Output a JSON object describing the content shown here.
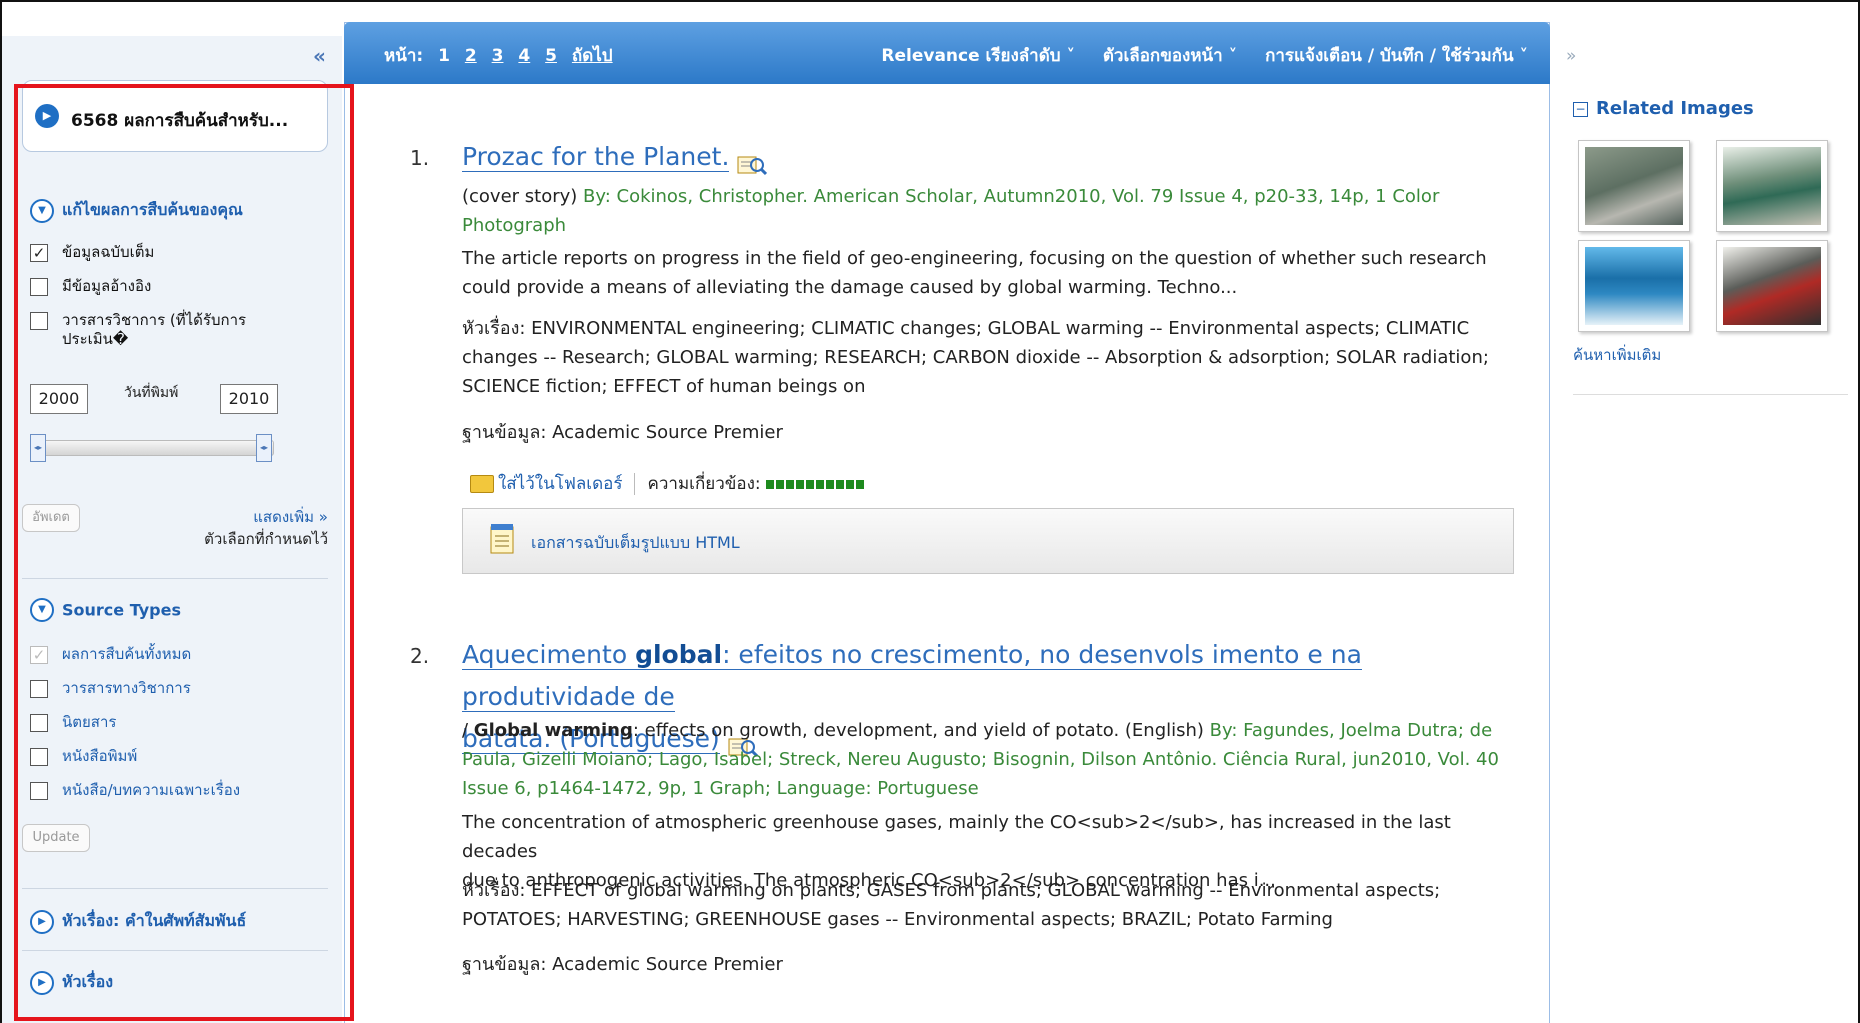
{
  "sidebar": {
    "collapse_label": "«",
    "results_count": "6568 ผลการสืบค้นสำหรับ...",
    "refine": {
      "heading": "แก้ไขผลการสืบค้นของคุณ",
      "full_text": "ข้อมูลฉบับเต็ม",
      "references": "มีข้อมูลอ้างอิง",
      "peer_reviewed_line1": "วารสารวิชาการ (ที่ได้รับการ",
      "peer_reviewed_line2": "ประเมิน�",
      "full_text_checked": true,
      "year_from": "2000",
      "year_label": "วันที่พิมพ์",
      "year_to": "2010",
      "update_label": "อัพเดต",
      "show_more": "แสดงเพิ่ม »",
      "options_set": "ตัวเลือกที่กำหนดไว้"
    },
    "source_types": {
      "heading": "Source Types",
      "items": [
        "ผลการสืบค้นทั้งหมด",
        "วารสารทางวิชาการ",
        "นิตยสาร",
        "หนังสือพิมพ์",
        "หนังสือ/บทความเฉพาะเรื่อง"
      ],
      "all_checked": true,
      "update_label": "Update"
    },
    "subject_thesaurus": "หัวเรื่อง: คำในศัพท์สัมพันธ์",
    "subject": "หัวเรื่อง"
  },
  "toolbar": {
    "page_label": "หน้า:",
    "pages": [
      "1",
      "2",
      "3",
      "4",
      "5"
    ],
    "next": "ถัดไป",
    "sort": "Relevance เรียงลำดับ ˅",
    "page_options": "ตัวเลือกของหน้า ˅",
    "alerts": "การแจ้งเตือน / บันทึก / ใช้ร่วมกัน ˅"
  },
  "results": [
    {
      "num": "1.",
      "title": "Prozac for the Planet.",
      "meta_prefix": "(cover story) ",
      "meta_line1": "By: Cokinos, Christopher. American Scholar, Autumn2010, Vol. 79 Issue 4, p20-33, 14p, 1 Color",
      "meta_line2": "Photograph",
      "abstract_line1": "The article reports on progress in the field of geo-engineering, focusing on the question of whether such research",
      "abstract_line2": "could provide a means of alleviating the damage caused by global warming. Techno...",
      "subjects_line1": "หัวเรื่อง: ENVIRONMENTAL engineering; CLIMATIC changes; GLOBAL warming -- Environmental aspects; CLIMATIC",
      "subjects_line2": "changes -- Research; GLOBAL warming; RESEARCH; CARBON dioxide -- Absorption & adsorption; SOLAR radiation;",
      "subjects_line3": "SCIENCE fiction; EFFECT of human beings on",
      "database": "ฐานข้อมูล: Academic Source Premier",
      "folder": "ใส่ไว้ในโฟลเดอร์",
      "relevance": "ความเกี่ยวข้อง:",
      "html_full_text": "เอกสารฉบับเต็มรูปแบบ HTML"
    },
    {
      "num": "2.",
      "title_a": "Aquecimento ",
      "title_b": "global",
      "title_c": ": efeitos no crescimento, no desenvols imento e na produtividade de",
      "title_d": "batata. (Portuguese)",
      "meta_a": "/ ",
      "meta_b": "Global warming",
      "meta_c": ": effects on growth, development, and yield of potato. (English) ",
      "meta_d": "By: Fagundes, Joelma Dutra; de",
      "meta_line2": "Paula, Gizelli Moiano; Lago, Isabel; Streck, Nereu Augusto; Bisognin, Dilson Antônio. Ciência Rural, jun2010, Vol. 40",
      "meta_line3": "Issue 6, p1464-1472, 9p, 1 Graph; Language: Portuguese",
      "abstract_line1": "The concentration of atmospheric greenhouse gases, mainly the CO<sub>2</sub>, has increased in the last decades",
      "abstract_line2": "due to anthropogenic activities. The atmospheric CO<sub>2</sub> concentration has i...",
      "subjects_line1": "หัวเรื่อง: EFFECT of global warming on plants; GASES from plants; GLOBAL warming -- Environmental aspects;",
      "subjects_line2": "POTATOES; HARVESTING; GREENHOUSE gases -- Environmental aspects; BRAZIL; Potato Farming",
      "database": "ฐานข้อมูล: Academic Source Premier"
    }
  ],
  "right_panel": {
    "expand_label": "»",
    "heading": "Related Images",
    "more": "ค้นหาเพิ่มเติม"
  }
}
